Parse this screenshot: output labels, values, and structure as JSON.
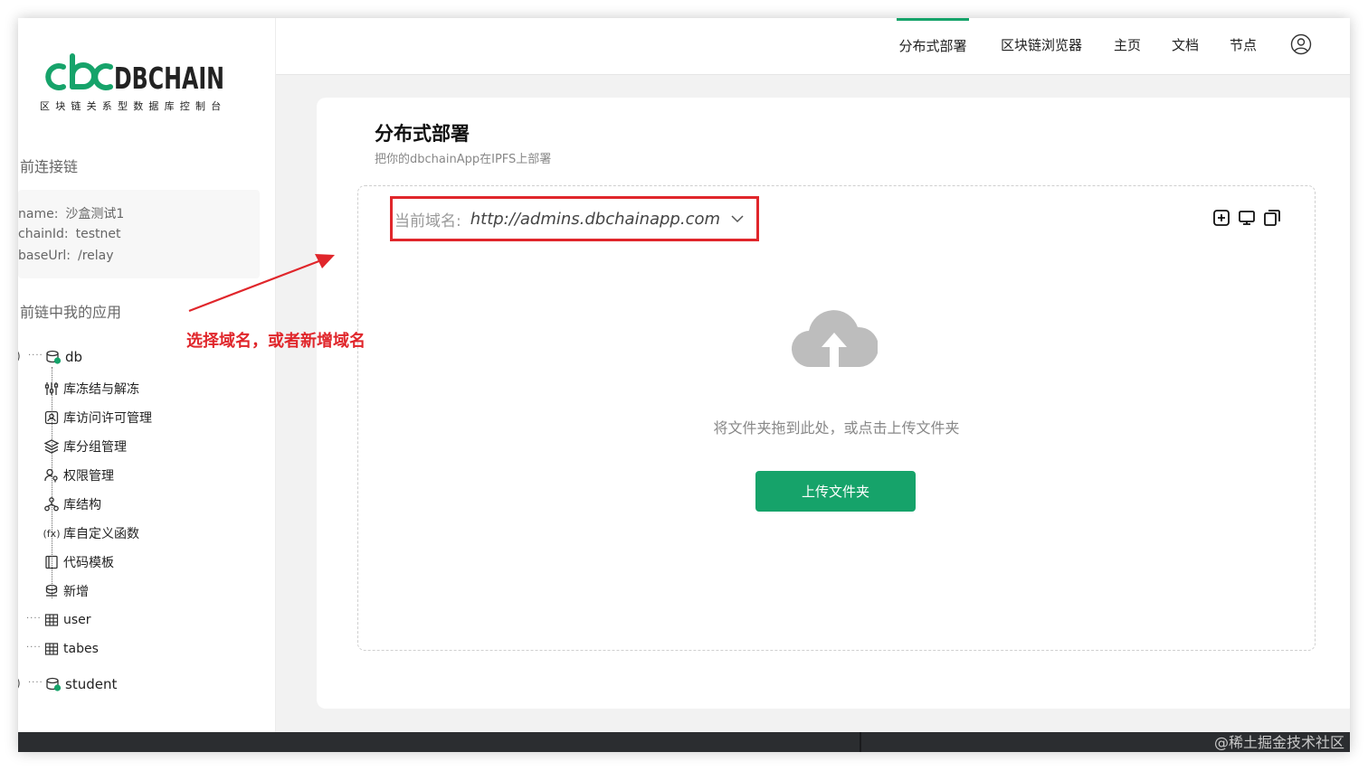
{
  "logo": {
    "brand": "cbcDBCHAIN",
    "subtitle": "区块链关系型数据库控制台"
  },
  "sidebar": {
    "current_chain_title": "前连接链",
    "chain_info": [
      {
        "key": "name:",
        "value": "沙盒测试1"
      },
      {
        "key": "chainId:",
        "value": "testnet"
      },
      {
        "key": "baseUrl:",
        "value": "/relay"
      }
    ],
    "my_apps_title": "前链中我的应用",
    "tree": {
      "db_label": "db",
      "db_children": [
        {
          "label": "库冻结与解冻",
          "icon": "freeze-icon"
        },
        {
          "label": "库访问许可管理",
          "icon": "access-icon"
        },
        {
          "label": "库分组管理",
          "icon": "layers-icon"
        },
        {
          "label": "权限管理",
          "icon": "permission-icon"
        },
        {
          "label": "库结构",
          "icon": "structure-icon"
        },
        {
          "label": "库自定义函数",
          "icon": "function-icon"
        },
        {
          "label": "代码模板",
          "icon": "template-icon"
        },
        {
          "label": "新增",
          "icon": "add-icon"
        }
      ],
      "tables": [
        {
          "label": "user"
        },
        {
          "label": "tabes"
        }
      ],
      "student_label": "student"
    }
  },
  "topnav": {
    "items": [
      {
        "label": "分布式部署",
        "active": true
      },
      {
        "label": "区块链浏览器",
        "active": false
      },
      {
        "label": "主页",
        "active": false
      },
      {
        "label": "文档",
        "active": false
      },
      {
        "label": "节点",
        "active": false
      }
    ],
    "user_icon": "user-circle-icon"
  },
  "main": {
    "title": "分布式部署",
    "subtitle": "把你的dbchainApp在IPFS上部署",
    "domain_label": "当前域名:",
    "domain_value": "http://admins.dbchainapp.com",
    "tool_icons": [
      "add-square-icon",
      "monitor-icon",
      "copy-icon"
    ],
    "drop_hint": "将文件夹拖到此处，或点击上传文件夹",
    "upload_button": "上传文件夹"
  },
  "annotation": {
    "text": "选择域名，或者新增域名"
  },
  "watermark": "@稀土掘金技术社区",
  "colors": {
    "brand_green": "#16a36a",
    "annotation_red": "#e0262b",
    "footer": "#2b2d30"
  }
}
